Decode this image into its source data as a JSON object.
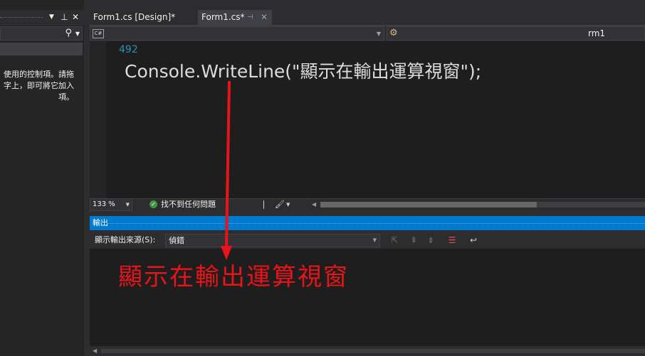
{
  "toolbox": {
    "hint_text": "使用的控制項。請拖\n字上，即可將它加入\n項。"
  },
  "tabs": [
    {
      "label": "Form1.cs [Design]*"
    },
    {
      "label": "Form1.cs*"
    }
  ],
  "navbar": {
    "language_badge": "C#",
    "member_text": "rm1"
  },
  "editor": {
    "line_number": "492",
    "code_line": "Console.WriteLine(\"顯示在輸出運算視窗\");"
  },
  "status": {
    "zoom": "133 %",
    "issues": "找不到任何問題"
  },
  "output": {
    "title": "輸出",
    "source_label": "顯示輸出來源(S):",
    "source_value": "偵錯"
  },
  "annotation": {
    "text": "顯示在輸出運算視窗",
    "color": "#e8141a"
  },
  "colors": {
    "accent": "#007acc",
    "editor_bg": "#1e1e1e",
    "chrome_bg": "#2d2d30"
  }
}
